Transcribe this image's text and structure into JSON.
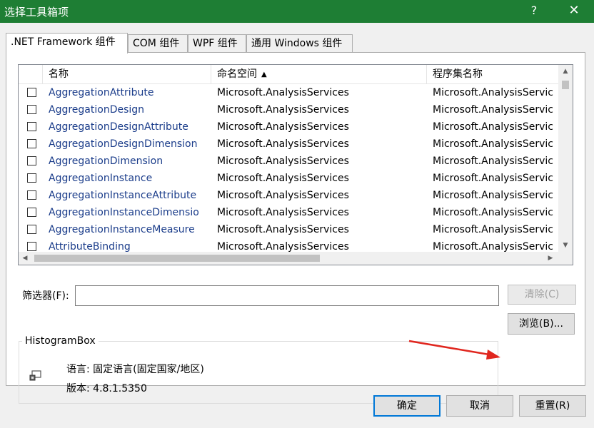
{
  "window": {
    "title": "选择工具箱项",
    "help_label": "?",
    "close_label": "✕"
  },
  "tabs": [
    {
      "label": ".NET Framework 组件",
      "active": true
    },
    {
      "label": "COM 组件",
      "active": false
    },
    {
      "label": "WPF 组件",
      "active": false
    },
    {
      "label": "通用 Windows 组件",
      "active": false
    }
  ],
  "list": {
    "columns": [
      "名称",
      "命名空间",
      "程序集名称"
    ],
    "sort_indicator": "▲",
    "rows": [
      {
        "name": "AggregationAttribute",
        "namespace": "Microsoft.AnalysisServices",
        "assembly": "Microsoft.AnalysisServic"
      },
      {
        "name": "AggregationDesign",
        "namespace": "Microsoft.AnalysisServices",
        "assembly": "Microsoft.AnalysisServic"
      },
      {
        "name": "AggregationDesignAttribute",
        "namespace": "Microsoft.AnalysisServices",
        "assembly": "Microsoft.AnalysisServic"
      },
      {
        "name": "AggregationDesignDimension",
        "namespace": "Microsoft.AnalysisServices",
        "assembly": "Microsoft.AnalysisServic"
      },
      {
        "name": "AggregationDimension",
        "namespace": "Microsoft.AnalysisServices",
        "assembly": "Microsoft.AnalysisServic"
      },
      {
        "name": "AggregationInstance",
        "namespace": "Microsoft.AnalysisServices",
        "assembly": "Microsoft.AnalysisServic"
      },
      {
        "name": "AggregationInstanceAttribute",
        "namespace": "Microsoft.AnalysisServices",
        "assembly": "Microsoft.AnalysisServic"
      },
      {
        "name": "AggregationInstanceDimensio",
        "namespace": "Microsoft.AnalysisServices",
        "assembly": "Microsoft.AnalysisServic"
      },
      {
        "name": "AggregationInstanceMeasure",
        "namespace": "Microsoft.AnalysisServices",
        "assembly": "Microsoft.AnalysisServic"
      },
      {
        "name": "AttributeBinding",
        "namespace": "Microsoft.AnalysisServices",
        "assembly": "Microsoft.AnalysisServic"
      }
    ]
  },
  "filter": {
    "label": "筛选器(F):",
    "value": "",
    "clear_label": "清除(C)"
  },
  "component_info": {
    "group_title": "HistogramBox",
    "language": "语言:  固定语言(固定国家/地区)",
    "version": "版本:  4.8.1.5350",
    "icon": "component-icon"
  },
  "buttons": {
    "browse": "浏览(B)...",
    "ok": "确定",
    "cancel": "取消",
    "reset": "重置(R)"
  },
  "colors": {
    "titlebar": "#1e7e34",
    "annotation_arrow": "#e0261e",
    "link_text": "#1a3c8a"
  }
}
